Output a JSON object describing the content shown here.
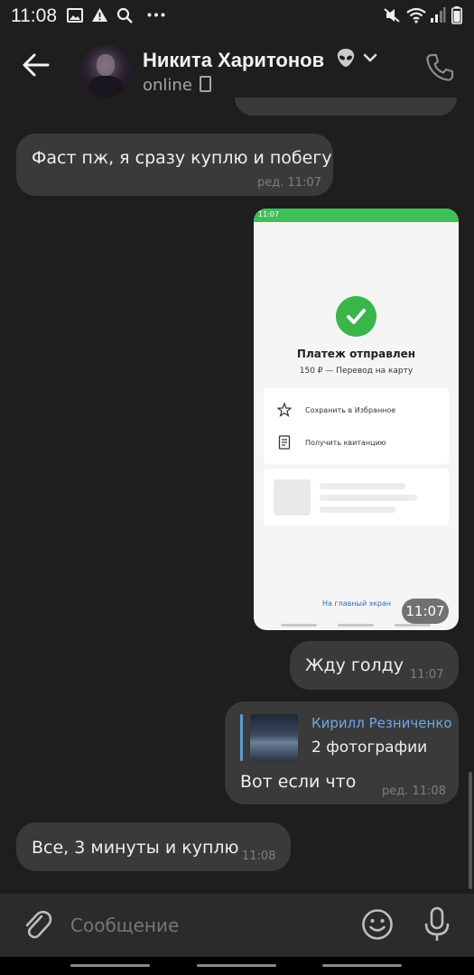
{
  "status_bar": {
    "time": "11:08",
    "icons": [
      "image-icon",
      "warning-icon",
      "search-icon",
      "more-icon"
    ],
    "right_icons": [
      "mute-icon",
      "wifi-icon",
      "signal-icon",
      "battery-icon"
    ]
  },
  "header": {
    "name": "Никита Харитонов",
    "emoji": "alien-icon",
    "status": "online"
  },
  "messages": [
    {
      "text": "Фаст пж, я сразу куплю и побегу",
      "time": "ред. 11:07",
      "side": "in"
    },
    {
      "type": "photo",
      "time": "11:07",
      "side": "out",
      "screenshot": {
        "status_time": "11:07",
        "title": "Платеж отправлен",
        "subtitle": "150 ₽ — Перевод на карту",
        "option1": "Сохранить в Избранное",
        "option2": "Получить квитанцию",
        "link": "На главный экран"
      }
    },
    {
      "text": "Жду голду",
      "time": "11:07",
      "side": "out"
    },
    {
      "reply_name": "Кирилл Резниченко",
      "reply_sub": "2 фотографии",
      "text": "Вот если что",
      "time": "ред. 11:08",
      "side": "out"
    },
    {
      "text": "Все, 3 минуты и куплю",
      "time": "11:08",
      "side": "in"
    }
  ],
  "composer": {
    "placeholder": "Сообщение"
  },
  "colors": {
    "bg": "#1e1e1e",
    "bubble": "#3a3a3a",
    "accent_green": "#39b54a",
    "link_blue": "#6ea8e6"
  }
}
